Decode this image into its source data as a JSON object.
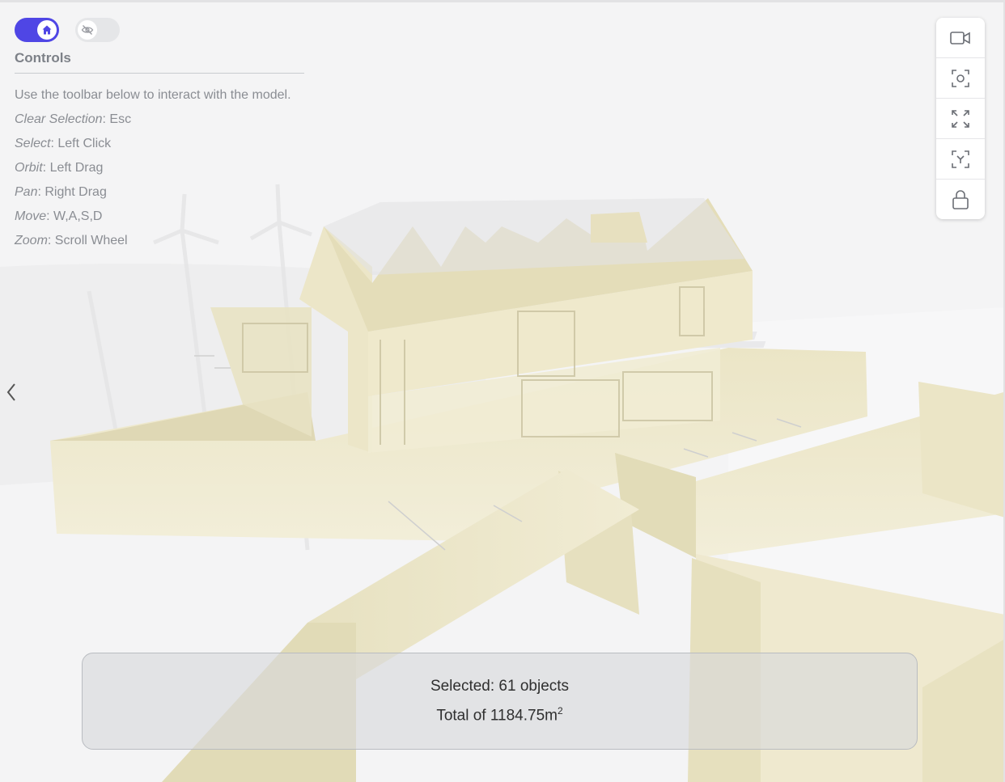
{
  "toggles": {
    "home": {
      "state": "on",
      "icon": "home-icon"
    },
    "hide": {
      "state": "off",
      "icon": "eye-off-icon"
    }
  },
  "controls": {
    "title": "Controls",
    "intro": "Use the toolbar below to interact with the model.",
    "items": [
      {
        "key": "Clear Selection",
        "value": ": Esc"
      },
      {
        "key": "Select",
        "value": ": Left Click"
      },
      {
        "key": "Orbit",
        "value": ": Left Drag"
      },
      {
        "key": "Pan",
        "value": ": Right Drag"
      },
      {
        "key": "Move",
        "value": ": W,A,S,D"
      },
      {
        "key": "Zoom",
        "value": ": Scroll Wheel"
      }
    ]
  },
  "toolbar": {
    "icons": [
      "video-camera-icon",
      "focus-icon",
      "expand-icon",
      "reset-view-icon",
      "lock-icon"
    ]
  },
  "selection": {
    "line1": "Selected: 61 objects",
    "line2": "Total of 1184.75m",
    "unit_sup": "2"
  },
  "colors": {
    "accent": "#4f46e5",
    "model_fill": "#efead0",
    "panel_bg": "#d6d8dc"
  }
}
